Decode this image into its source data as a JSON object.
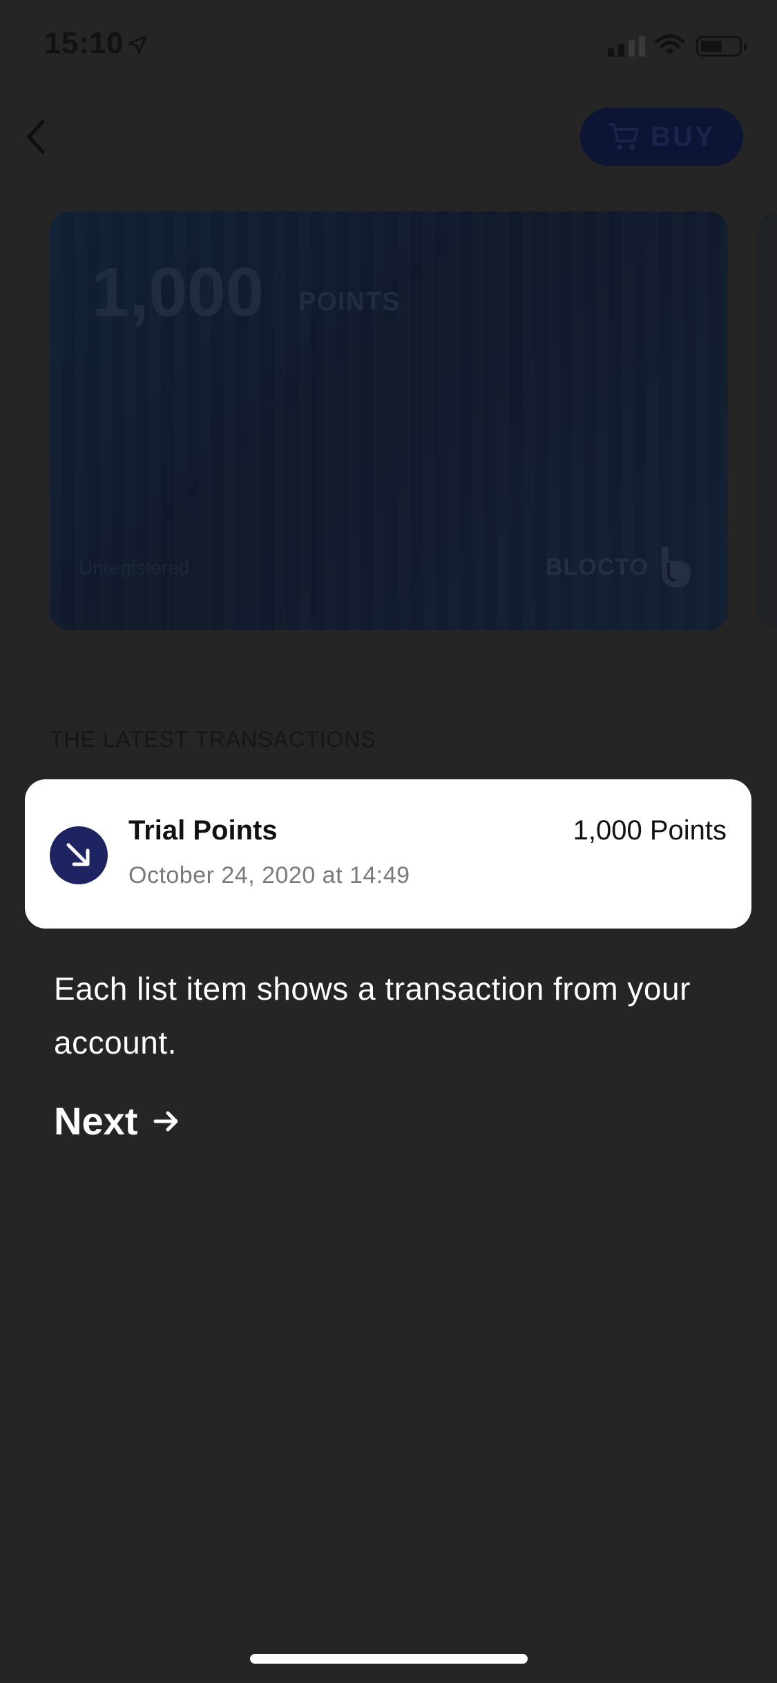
{
  "status_bar": {
    "time": "15:10"
  },
  "header": {
    "buy_label": "BUY"
  },
  "card": {
    "amount": "1,000",
    "unit": "POINTS",
    "status": "Unregistered",
    "brand": "BLOCTO"
  },
  "section": {
    "heading": "THE LATEST TRANSACTIONS"
  },
  "transaction": {
    "title": "Trial Points",
    "date": "October 24, 2020 at 14:49",
    "amount": "1,000 Points"
  },
  "tooltip": {
    "text": "Each list item shows a transaction from your account.",
    "next_label": "Next"
  },
  "colors": {
    "background": "#252525",
    "highlight_card": "#ffffff",
    "tx_icon": "#1e2462",
    "buy_button": "#0d1535"
  },
  "icons": [
    "location-arrow-icon",
    "signal-icon",
    "wifi-icon",
    "battery-icon",
    "back-chevron-icon",
    "cart-icon",
    "blocto-logo-icon",
    "incoming-arrow-icon",
    "arrow-right-icon"
  ]
}
